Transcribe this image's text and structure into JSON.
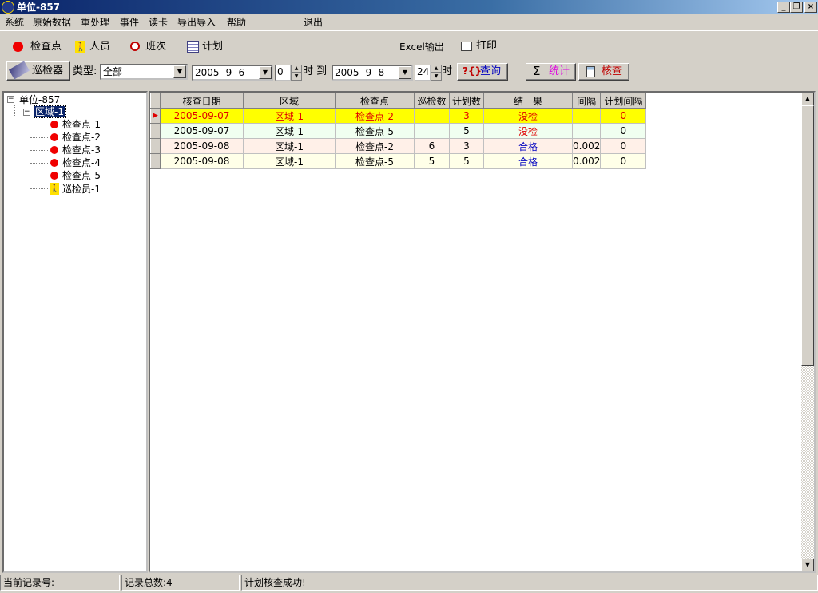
{
  "window": {
    "title": "单位-857"
  },
  "menu": [
    "系统",
    "原始数据",
    "重处理",
    "事件",
    "读卡",
    "导出导入",
    "帮助",
    "退出"
  ],
  "toolbar": {
    "checkpoint_label": "检查点",
    "personnel_label": "人员",
    "shift_label": "班次",
    "plan_label": "计划",
    "excel_label": "Excel输出",
    "print_label": "打印",
    "inspector_label": "巡检器",
    "type_label": "类型:",
    "type_value": "全部",
    "start_date": "2005- 9- 6",
    "start_hour": "0",
    "hour_to_label": "时 到",
    "end_date": "2005- 9- 8",
    "end_hour": "24",
    "hour_label": "时",
    "query_label": "查询",
    "query_prefix": "?{}",
    "stats_label": "统计",
    "stats_sigma": "Σ",
    "check_label": "核查"
  },
  "tree": {
    "root": "单位-857",
    "area": "区域-1",
    "children": [
      "检查点-1",
      "检查点-2",
      "检查点-3",
      "检查点-4",
      "检查点-5",
      "巡检员-1"
    ]
  },
  "grid": {
    "columns": [
      "核查日期",
      "区域",
      "检查点",
      "巡检数",
      "计划数",
      "结　果",
      "间隔",
      "计划间隔"
    ],
    "rows": [
      {
        "date": "2005-09-07",
        "area": "区域-1",
        "point": "检查点-2",
        "patrol": "",
        "plan": "3",
        "result": "没检",
        "interval": "",
        "plan_interval": "0"
      },
      {
        "date": "2005-09-07",
        "area": "区域-1",
        "point": "检查点-5",
        "patrol": "",
        "plan": "5",
        "result": "没检",
        "interval": "",
        "plan_interval": "0"
      },
      {
        "date": "2005-09-08",
        "area": "区域-1",
        "point": "检查点-2",
        "patrol": "6",
        "plan": "3",
        "result": "合格",
        "interval": "0.002",
        "plan_interval": "0"
      },
      {
        "date": "2005-09-08",
        "area": "区域-1",
        "point": "检查点-5",
        "patrol": "5",
        "plan": "5",
        "result": "合格",
        "interval": "0.002",
        "plan_interval": "0"
      }
    ]
  },
  "status": {
    "current_record": "当前记录号:",
    "total_records": "记录总数:4",
    "message": "计划核查成功!"
  },
  "colors": {
    "selected_row": "#ffff00",
    "row_even": "#f0fff0",
    "row_alt": "#fff0e8",
    "row_cream": "#ffffe8"
  }
}
